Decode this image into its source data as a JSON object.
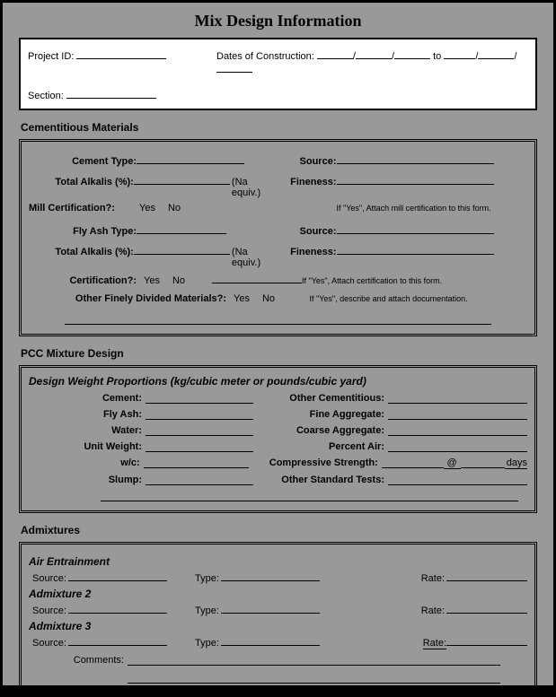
{
  "title": "Mix Design Information",
  "header": {
    "project_id_label": "Project ID:",
    "dates_label": "Dates of Construction:",
    "dates_sep1": "/",
    "dates_sep2": "/",
    "dates_to": "to",
    "section_label": "Section:"
  },
  "cementitious": {
    "section_title": "Cementitious Materials",
    "cement_type_label": "Cement Type:",
    "source_label": "Source:",
    "total_alkalis_label": "Total Alkalis (%):",
    "na_equiv": "(Na equiv.)",
    "fineness_label": "Fineness:",
    "mill_cert_label": "Mill Certification?:",
    "yes": "Yes",
    "no": "No",
    "mill_cert_note": "If \"Yes\", Attach mill certification to this form.",
    "fly_ash_type_label": "Fly Ash Type:",
    "certification_label": "Certification?:",
    "cert_note": "If \"Yes\", Attach certification to this form.",
    "other_finely_label": "Other Finely Divided Materials?:",
    "other_note": "If \"Yes\", describe and attach documentation."
  },
  "pcc": {
    "section_title": "PCC Mixture Design",
    "design_header": "Design Weight Proportions (kg/cubic meter or pounds/cubic yard)",
    "cement": "Cement:",
    "other_cementitious": "Other Cementitious:",
    "fly_ash": "Fly Ash:",
    "fine_aggregate": "Fine Aggregate:",
    "water": "Water:",
    "coarse_aggregate": "Coarse Aggregate:",
    "unit_weight": "Unit Weight:",
    "percent_air": "Percent Air:",
    "wc": "w/c:",
    "compressive_strength": "Compressive Strength:",
    "at": "@",
    "days": "days",
    "slump": "Slump:",
    "other_tests": "Other Standard Tests:"
  },
  "admixtures": {
    "section_title": "Admixtures",
    "air_entrainment": "Air Entrainment",
    "admixture2": "Admixture 2",
    "admixture3": "Admixture 3",
    "source": "Source:",
    "type": "Type:",
    "rate": "Rate:",
    "comments": "Comments:"
  }
}
